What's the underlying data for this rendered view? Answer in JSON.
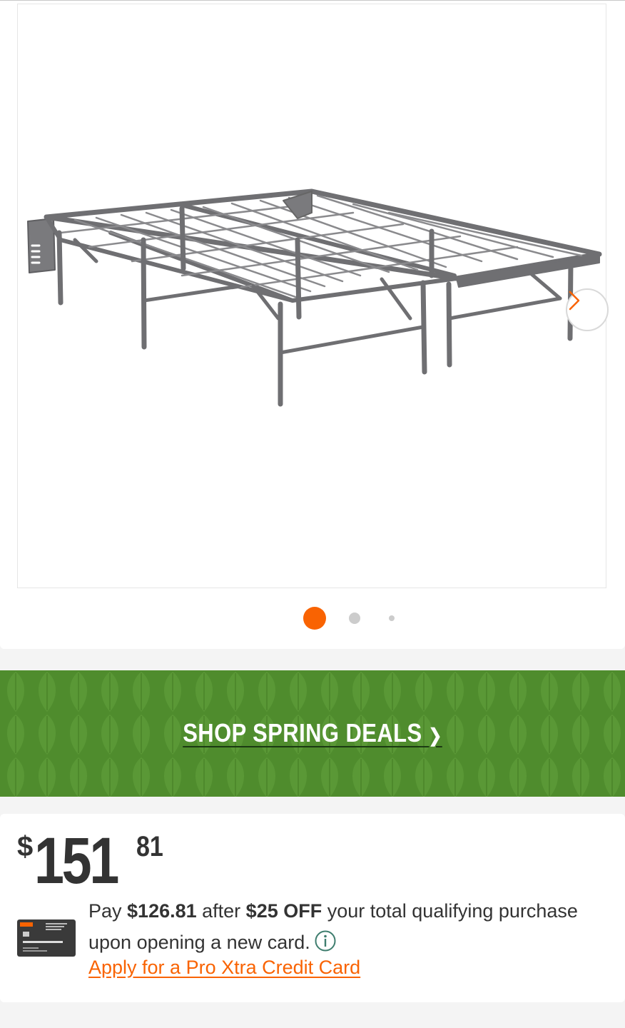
{
  "gallery": {
    "image_alt": "Metal platform bed frame",
    "next_icon": "chevron-right-icon",
    "dots": [
      {
        "active": true
      },
      {
        "active": false
      },
      {
        "active": false
      }
    ],
    "colors": {
      "active_dot": "#f96302",
      "inactive_dot": "#cccccc",
      "next_chevron": "#f96302"
    }
  },
  "banner": {
    "label": "SHOP SPRING DEALS",
    "arrow": "❯",
    "colors": {
      "background": "#4f8c2d",
      "leaf": "#5a9836",
      "text": "#ffffff"
    }
  },
  "price": {
    "currency": "$",
    "dollars": "151",
    "cents": "81"
  },
  "offer": {
    "card_icon": "credit-card-icon",
    "pay_prefix": "Pay ",
    "discounted_price": "$126.81",
    "after_text": " after ",
    "discount": "$25 OFF",
    "rest_text": " your total qualifying purchase upon opening a new card.",
    "info_icon": "info-icon",
    "apply_link": "Apply for a Pro Xtra Credit Card",
    "colors": {
      "link": "#f96302",
      "info": "#3e7d6e"
    }
  }
}
